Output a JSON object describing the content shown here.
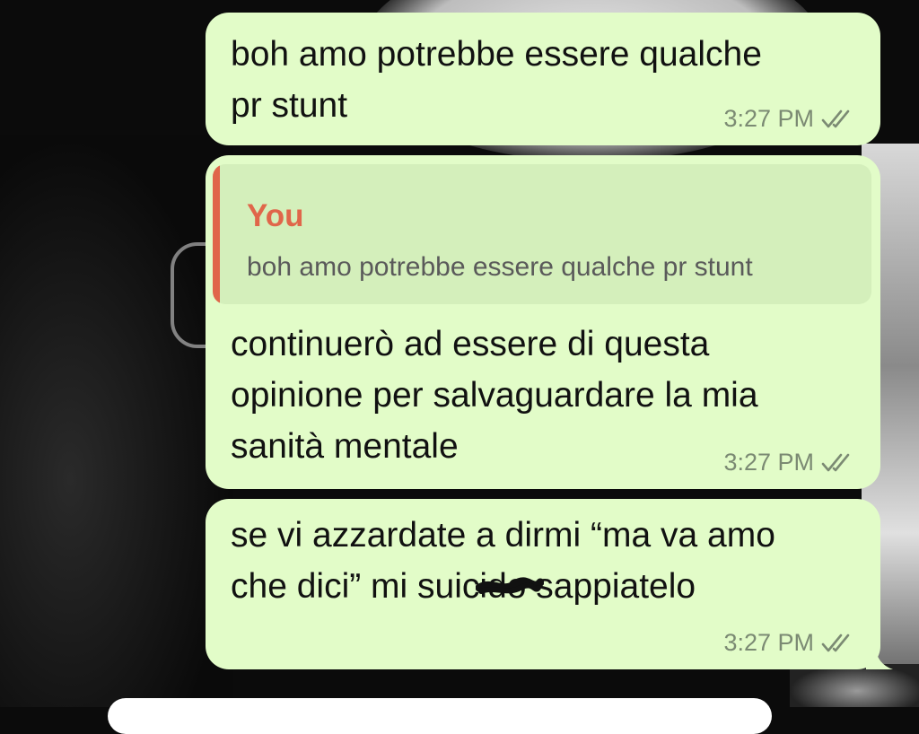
{
  "chat": {
    "messages": [
      {
        "text": "boh amo potrebbe essere qualche\npr stunt",
        "time": "3:27 PM",
        "status": "read"
      },
      {
        "reply_to": {
          "author": "You",
          "text": "boh amo potrebbe essere qualche pr stunt"
        },
        "text": "continuerò ad essere di questa\nopinione per salvaguardare la mia\nsanità mentale",
        "time": "3:27 PM",
        "status": "read"
      },
      {
        "text": "se vi azzardate a dirmi “ma va amo\nche dici” mi suicido sappiatelo",
        "time": "3:27 PM",
        "status": "read"
      }
    ]
  },
  "colors": {
    "bubble": "#e2fcc8",
    "quote_bg": "#d4efbb",
    "quote_accent": "#e0664a",
    "meta": "#7b8a73"
  },
  "icons": {
    "read_receipt": "double-check-icon"
  }
}
